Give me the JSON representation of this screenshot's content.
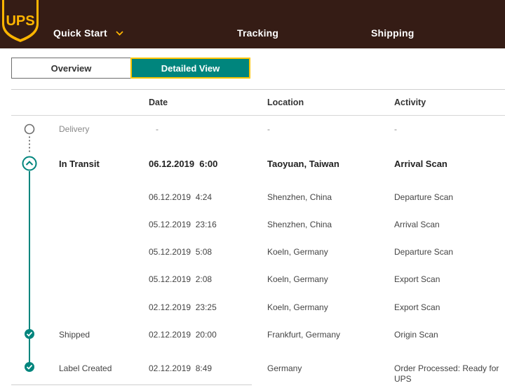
{
  "header": {
    "logo_text": "UPS",
    "nav": [
      {
        "label": "Quick Start"
      },
      {
        "label": "Tracking"
      },
      {
        "label": "Shipping"
      }
    ]
  },
  "view_toggle": {
    "overview_label": "Overview",
    "detailed_label": "Detailed View",
    "active": "Detailed View"
  },
  "table": {
    "columns": {
      "date": "Date",
      "location": "Location",
      "activity": "Activity"
    },
    "rows": [
      {
        "status": "Delivery",
        "date": "-",
        "location": "-",
        "activity": "-"
      },
      {
        "status": "In Transit",
        "date": "06.12.2019  6:00",
        "location": "Taoyuan, Taiwan",
        "activity": "Arrival Scan"
      },
      {
        "status": "",
        "date": "06.12.2019  4:24",
        "location": "Shenzhen, China",
        "activity": "Departure Scan"
      },
      {
        "status": "",
        "date": "05.12.2019  23:16",
        "location": "Shenzhen, China",
        "activity": "Arrival Scan"
      },
      {
        "status": "",
        "date": "05.12.2019  5:08",
        "location": "Koeln, Germany",
        "activity": "Departure Scan"
      },
      {
        "status": "",
        "date": "05.12.2019  2:08",
        "location": "Koeln, Germany",
        "activity": "Export Scan"
      },
      {
        "status": "",
        "date": "02.12.2019  23:25",
        "location": "Koeln, Germany",
        "activity": "Export Scan"
      },
      {
        "status": "Shipped",
        "date": "02.12.2019  20:00",
        "location": "Frankfurt, Germany",
        "activity": "Origin Scan"
      },
      {
        "status": "Label Created",
        "date": "02.12.2019  8:49",
        "location": "Germany",
        "activity": "Order Processed: Ready for UPS"
      }
    ]
  },
  "colors": {
    "brand_brown": "#351c15",
    "brand_gold": "#ffb500",
    "accent_teal": "#00857d"
  }
}
